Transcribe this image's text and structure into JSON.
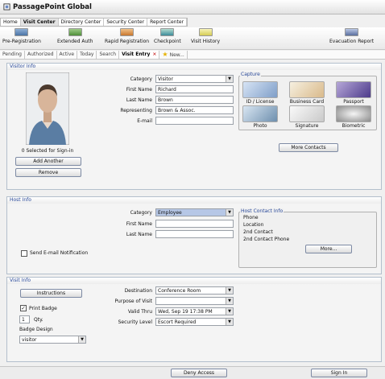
{
  "window_title": "PassagePoint Global",
  "menu": [
    "Home",
    "Visit Center",
    "Directory Center",
    "Security Center",
    "Report Center"
  ],
  "toolbar": {
    "items": [
      "Pre-Registration",
      "Extended Auth",
      "Rapid Registration",
      "Checkpoint",
      "Visit History"
    ],
    "evacuation": "Evacuation Report"
  },
  "tabs": [
    "Pending",
    "Authorized",
    "Active",
    "Today",
    "Search",
    "Visit Entry",
    "New..."
  ],
  "visitor": {
    "header": "Visitor Info",
    "category_label": "Category",
    "category": "Visitor",
    "first_label": "First Name",
    "first": "Richard",
    "last_label": "Last Name",
    "last": "Brown",
    "rep_label": "Representing",
    "rep": "Brown & Assoc.",
    "email_label": "E-mail",
    "email": "",
    "selected": "0 Selected for Sign-in",
    "add_another": "Add Another",
    "remove": "Remove"
  },
  "capture": {
    "title": "Capture",
    "items": [
      "ID / License",
      "Business Card",
      "Passport",
      "Photo",
      "Signature",
      "Biometric"
    ],
    "more_contacts": "More Contacts"
  },
  "host": {
    "header": "Host Info",
    "category_label": "Category",
    "category": "Employee",
    "first_label": "First Name",
    "first": "",
    "last_label": "Last Name",
    "last": "",
    "send_email": "Send E-mail Notification",
    "contact_title": "Host Contact Info",
    "contact_fields": [
      "Phone",
      "Location",
      "2nd Contact",
      "2nd Contact Phone"
    ],
    "more": "More..."
  },
  "visit": {
    "header": "Visit Info",
    "instructions": "Instructions",
    "print_badge": "Print Badge",
    "qty_value": "1",
    "qty_label": "Qty.",
    "badge_design_label": "Badge Design",
    "badge_design": "visitor",
    "destination_label": "Destination",
    "destination": "Conference Room",
    "purpose_label": "Purpose of Visit",
    "purpose": "",
    "valid_label": "Valid Thru",
    "valid": "Wed, Sep 19  17:38 PM",
    "security_label": "Security Level",
    "security": "Escort Required"
  },
  "footer": {
    "deny": "Deny Access",
    "sign_in": "Sign In"
  },
  "colors": {
    "panel_header_text": "#2a4a9a",
    "host_category_highlight": "#b6c7e6"
  }
}
